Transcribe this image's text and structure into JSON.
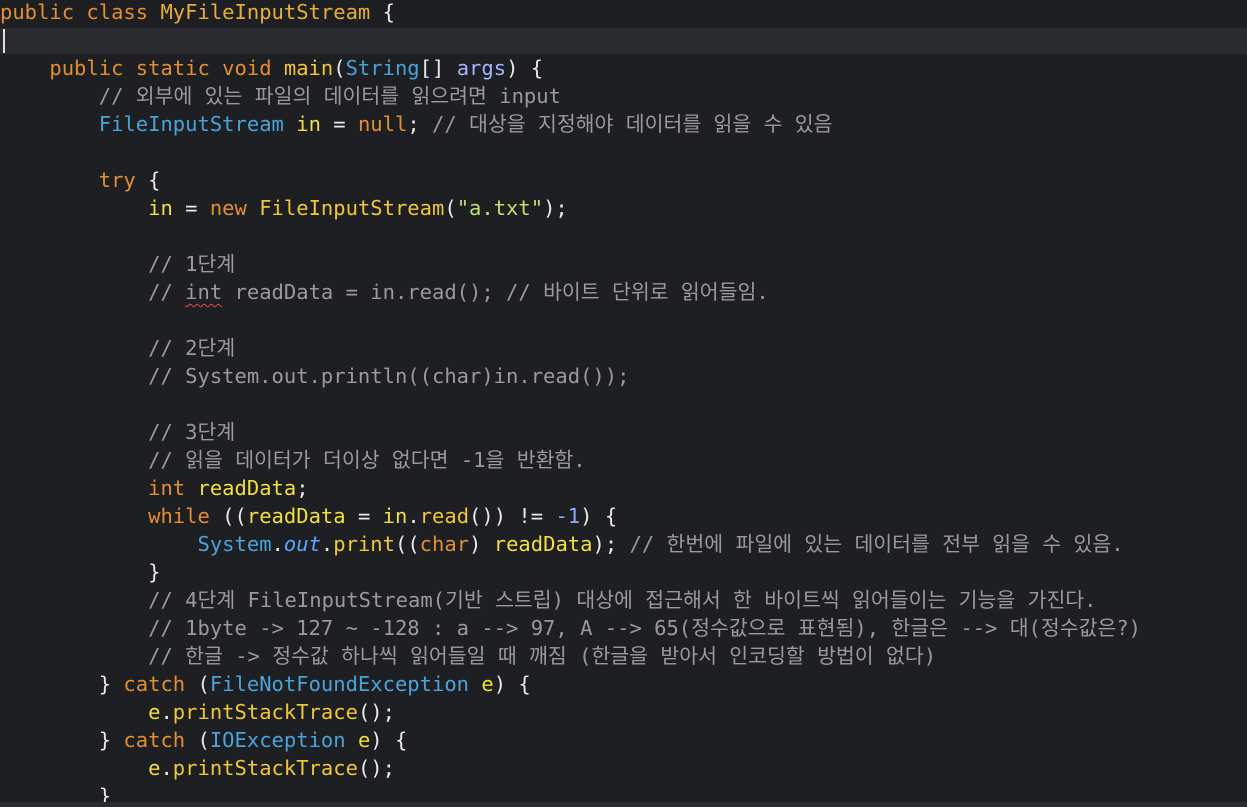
{
  "editor": {
    "lines": [
      {
        "tokens": [
          {
            "t": "kw",
            "v": "public class "
          },
          {
            "t": "cls",
            "v": "MyFileInputStream"
          },
          {
            "t": "plain",
            "v": " {"
          }
        ]
      },
      {
        "tokens": []
      },
      {
        "tokens": [
          {
            "t": "plain",
            "v": "    "
          },
          {
            "t": "kw",
            "v": "public static void "
          },
          {
            "t": "fn",
            "v": "main"
          },
          {
            "t": "plain",
            "v": "("
          },
          {
            "t": "type",
            "v": "String"
          },
          {
            "t": "plain",
            "v": "[] "
          },
          {
            "t": "param",
            "v": "args"
          },
          {
            "t": "plain",
            "v": ") {"
          }
        ]
      },
      {
        "tokens": [
          {
            "t": "cmt",
            "v": "        // 외부에 있는 파일의 데이터를 읽으려면 input"
          }
        ]
      },
      {
        "tokens": [
          {
            "t": "plain",
            "v": "        "
          },
          {
            "t": "type",
            "v": "FileInputStream "
          },
          {
            "t": "var",
            "v": "in"
          },
          {
            "t": "plain",
            "v": " = "
          },
          {
            "t": "kw",
            "v": "null"
          },
          {
            "t": "plain",
            "v": "; "
          },
          {
            "t": "cmt",
            "v": "// 대상을 지정해야 데이터를 읽을 수 있음"
          }
        ]
      },
      {
        "tokens": []
      },
      {
        "tokens": [
          {
            "t": "plain",
            "v": "        "
          },
          {
            "t": "kw",
            "v": "try"
          },
          {
            "t": "plain",
            "v": " {"
          }
        ]
      },
      {
        "tokens": [
          {
            "t": "plain",
            "v": "            "
          },
          {
            "t": "var",
            "v": "in"
          },
          {
            "t": "plain",
            "v": " = "
          },
          {
            "t": "kw",
            "v": "new "
          },
          {
            "t": "fn",
            "v": "FileInputStream"
          },
          {
            "t": "plain",
            "v": "("
          },
          {
            "t": "str",
            "v": "\"a.txt\""
          },
          {
            "t": "plain",
            "v": ");"
          }
        ]
      },
      {
        "tokens": []
      },
      {
        "tokens": [
          {
            "t": "cmt",
            "v": "            // 1단계"
          }
        ]
      },
      {
        "tokens": [
          {
            "t": "cmt",
            "v": "            // "
          },
          {
            "t": "cmt-squiggle",
            "v": "int"
          },
          {
            "t": "cmt",
            "v": " readData = in.read(); // 바이트 단위로 읽어들임."
          }
        ]
      },
      {
        "tokens": []
      },
      {
        "tokens": [
          {
            "t": "cmt",
            "v": "            // 2단계"
          }
        ]
      },
      {
        "tokens": [
          {
            "t": "cmt",
            "v": "            // System.out.println((char)in.read());"
          }
        ]
      },
      {
        "tokens": []
      },
      {
        "tokens": [
          {
            "t": "cmt",
            "v": "            // 3단계"
          }
        ]
      },
      {
        "tokens": [
          {
            "t": "cmt",
            "v": "            // 읽을 데이터가 더이상 없다면 -1을 반환함."
          }
        ]
      },
      {
        "tokens": [
          {
            "t": "plain",
            "v": "            "
          },
          {
            "t": "kw",
            "v": "int "
          },
          {
            "t": "var",
            "v": "readData"
          },
          {
            "t": "plain",
            "v": ";"
          }
        ]
      },
      {
        "tokens": [
          {
            "t": "plain",
            "v": "            "
          },
          {
            "t": "kw",
            "v": "while"
          },
          {
            "t": "plain",
            "v": " (("
          },
          {
            "t": "var",
            "v": "readData"
          },
          {
            "t": "plain",
            "v": " = "
          },
          {
            "t": "var",
            "v": "in"
          },
          {
            "t": "plain",
            "v": "."
          },
          {
            "t": "fn",
            "v": "read"
          },
          {
            "t": "plain",
            "v": "()) != "
          },
          {
            "t": "num",
            "v": "-1"
          },
          {
            "t": "plain",
            "v": ") {"
          }
        ]
      },
      {
        "tokens": [
          {
            "t": "plain",
            "v": "                "
          },
          {
            "t": "type",
            "v": "System"
          },
          {
            "t": "plain",
            "v": "."
          },
          {
            "t": "static-field",
            "v": "out"
          },
          {
            "t": "plain",
            "v": "."
          },
          {
            "t": "fn",
            "v": "print"
          },
          {
            "t": "plain",
            "v": "(("
          },
          {
            "t": "kw",
            "v": "char"
          },
          {
            "t": "plain",
            "v": ") "
          },
          {
            "t": "var",
            "v": "readData"
          },
          {
            "t": "plain",
            "v": "); "
          },
          {
            "t": "cmt",
            "v": "// 한번에 파일에 있는 데이터를 전부 읽을 수 있음."
          }
        ]
      },
      {
        "tokens": [
          {
            "t": "plain",
            "v": "            }"
          }
        ]
      },
      {
        "tokens": [
          {
            "t": "cmt",
            "v": "            // 4단계 FileInputStream(기반 스트립) 대상에 접근해서 한 바이트씩 읽어들이는 기능을 가진다."
          }
        ]
      },
      {
        "tokens": [
          {
            "t": "cmt",
            "v": "            // 1byte -> 127 ~ -128 : a --> 97, A --> 65(정수값으로 표현됨), 한글은 --> 대(정수값은?)"
          }
        ]
      },
      {
        "tokens": [
          {
            "t": "cmt",
            "v": "            // 한글 -> 정수값 하나씩 읽어들일 때 깨짐 (한글을 받아서 인코딩할 방법이 없다)"
          }
        ]
      },
      {
        "tokens": [
          {
            "t": "plain",
            "v": "        } "
          },
          {
            "t": "kw",
            "v": "catch"
          },
          {
            "t": "plain",
            "v": " ("
          },
          {
            "t": "type",
            "v": "FileNotFoundException "
          },
          {
            "t": "var",
            "v": "e"
          },
          {
            "t": "plain",
            "v": ") {"
          }
        ]
      },
      {
        "tokens": [
          {
            "t": "plain",
            "v": "            "
          },
          {
            "t": "var",
            "v": "e"
          },
          {
            "t": "plain",
            "v": "."
          },
          {
            "t": "fn",
            "v": "printStackTrace"
          },
          {
            "t": "plain",
            "v": "();"
          }
        ]
      },
      {
        "tokens": [
          {
            "t": "plain",
            "v": "        } "
          },
          {
            "t": "kw",
            "v": "catch"
          },
          {
            "t": "plain",
            "v": " ("
          },
          {
            "t": "type",
            "v": "IOException "
          },
          {
            "t": "var",
            "v": "e"
          },
          {
            "t": "plain",
            "v": ") {"
          }
        ]
      },
      {
        "tokens": [
          {
            "t": "plain",
            "v": "            "
          },
          {
            "t": "var",
            "v": "e"
          },
          {
            "t": "plain",
            "v": "."
          },
          {
            "t": "fn",
            "v": "printStackTrace"
          },
          {
            "t": "plain",
            "v": "();"
          }
        ]
      },
      {
        "tokens": [
          {
            "t": "plain",
            "v": "        }"
          }
        ]
      }
    ]
  }
}
